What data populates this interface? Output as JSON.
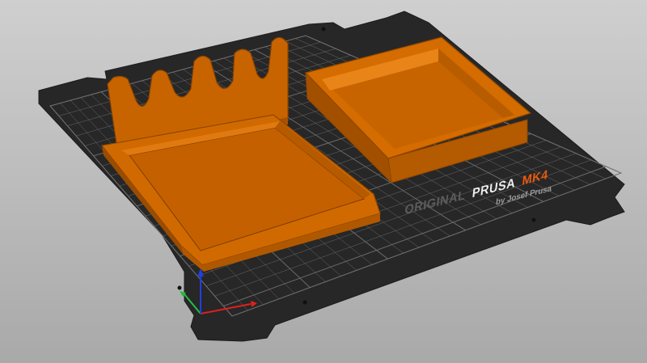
{
  "viewport": {
    "background_top": "#cfcfcf",
    "background_bottom": "#a9a9a9"
  },
  "bed": {
    "brand_prefix": "ORIGINAL",
    "brand_name": "PRUSA",
    "model": "MK4",
    "byline": "by Josef Prusa",
    "plate_color": "#262626",
    "grid_color": "#6a6a6a",
    "text_color": "#5a5a5a",
    "brand_color": "#ededed",
    "model_color": "#e8590c"
  },
  "objects": [
    {
      "name": "tool-holder-tray",
      "color": "#cc6400"
    },
    {
      "name": "square-box",
      "color": "#cc6400"
    }
  ],
  "axes": {
    "x_color": "#e02020",
    "y_color": "#22c040",
    "z_color": "#2040e0"
  }
}
